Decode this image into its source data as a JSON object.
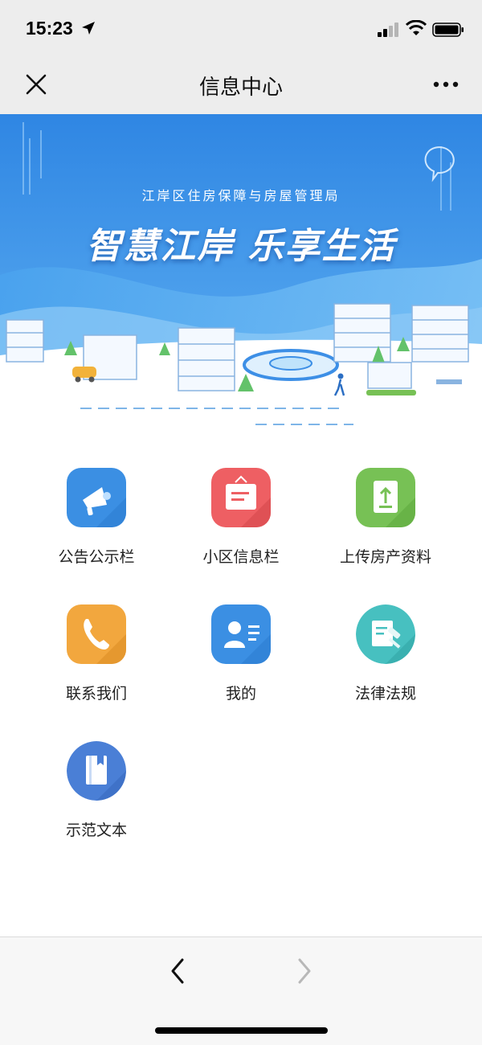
{
  "status_bar": {
    "time": "15:23",
    "icons": [
      "location-arrow-icon",
      "cellular-signal-icon",
      "wifi-icon",
      "battery-icon"
    ]
  },
  "nav": {
    "title": "信息中心",
    "close_icon": "close-icon",
    "more_icon": "more-dots-icon"
  },
  "banner": {
    "subtitle": "江岸区住房保障与房屋管理局",
    "title": "智慧江岸 乐享生活",
    "colors": {
      "sky": "#3d8fe6",
      "wave": "#5aaaf0",
      "ground": "#ffffff"
    }
  },
  "grid": {
    "items": [
      {
        "label": "公告公示栏",
        "icon": "megaphone-icon",
        "color": "#3b8fe3"
      },
      {
        "label": "小区信息栏",
        "icon": "notice-board-icon",
        "color": "#ee5f63"
      },
      {
        "label": "上传房产资料",
        "icon": "upload-document-icon",
        "color": "#77c155"
      },
      {
        "label": "联系我们",
        "icon": "phone-icon",
        "color": "#f2a73e"
      },
      {
        "label": "我的",
        "icon": "user-card-icon",
        "color": "#3b8fe3"
      },
      {
        "label": "法律法规",
        "icon": "law-hammer-icon",
        "color": "#47c0c0"
      },
      {
        "label": "示范文本",
        "icon": "book-icon",
        "color": "#4a7fd6"
      }
    ]
  },
  "bottom_bar": {
    "back_icon": "chevron-left-icon",
    "forward_icon": "chevron-right-icon"
  }
}
